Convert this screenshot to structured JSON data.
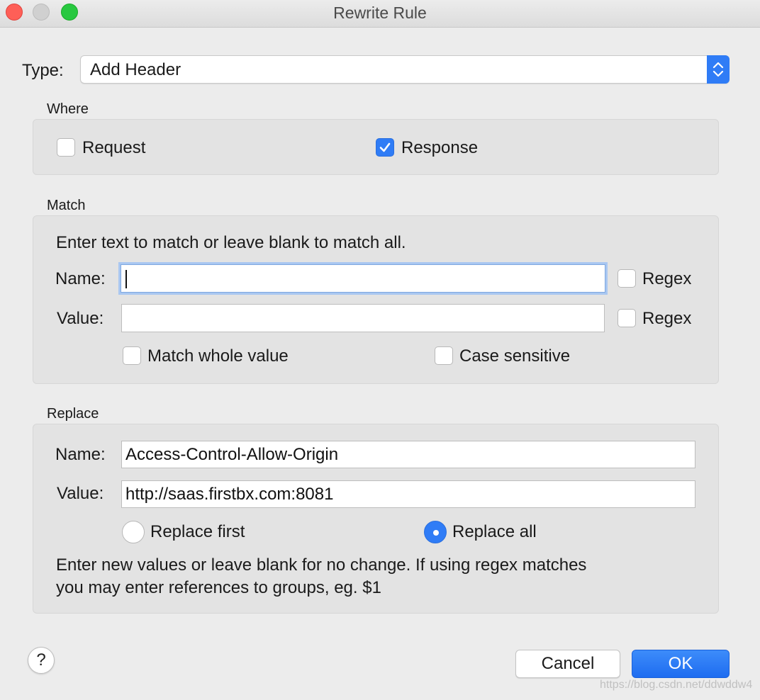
{
  "window": {
    "title": "Rewrite Rule"
  },
  "type": {
    "label": "Type:",
    "selected": "Add Header"
  },
  "where": {
    "title": "Where",
    "request": {
      "label": "Request",
      "checked": false
    },
    "response": {
      "label": "Response",
      "checked": true
    }
  },
  "match": {
    "title": "Match",
    "instructions": "Enter text to match or leave blank to match all.",
    "name_label": "Name:",
    "name_value": "",
    "name_regex_label": "Regex",
    "value_label": "Value:",
    "value_value": "",
    "value_regex_label": "Regex",
    "match_whole_label": "Match whole value",
    "case_sensitive_label": "Case sensitive"
  },
  "replace": {
    "title": "Replace",
    "name_label": "Name:",
    "name_value": "Access-Control-Allow-Origin",
    "value_label": "Value:",
    "value_value": "http://saas.firstbx.com:8081",
    "replace_first_label": "Replace first",
    "replace_all_label": "Replace all",
    "selected_mode": "Replace all",
    "help_line1": "Enter new values or leave blank for no change. If using regex matches",
    "help_line2": "you may enter references to groups, eg. $1"
  },
  "footer": {
    "help_glyph": "?",
    "cancel_label": "Cancel",
    "ok_label": "OK"
  },
  "watermark": "https://blog.csdn.net/ddwddw4",
  "colors": {
    "accent": "#2f7cf6",
    "background": "#ececec",
    "group": "#e3e3e3"
  }
}
